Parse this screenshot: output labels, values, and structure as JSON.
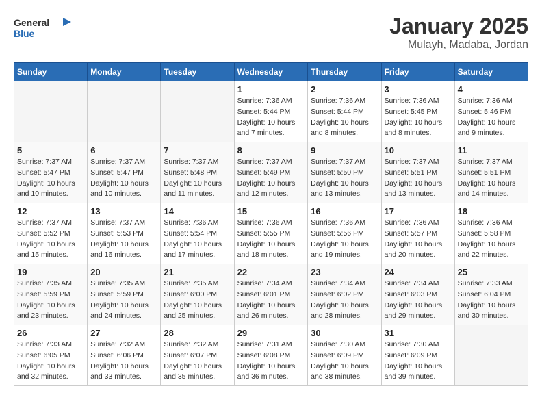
{
  "logo": {
    "general": "General",
    "blue": "Blue"
  },
  "title": "January 2025",
  "subtitle": "Mulayh, Madaba, Jordan",
  "days_of_week": [
    "Sunday",
    "Monday",
    "Tuesday",
    "Wednesday",
    "Thursday",
    "Friday",
    "Saturday"
  ],
  "weeks": [
    [
      {
        "day": "",
        "info": ""
      },
      {
        "day": "",
        "info": ""
      },
      {
        "day": "",
        "info": ""
      },
      {
        "day": "1",
        "info": "Sunrise: 7:36 AM\nSunset: 5:44 PM\nDaylight: 10 hours and 7 minutes."
      },
      {
        "day": "2",
        "info": "Sunrise: 7:36 AM\nSunset: 5:44 PM\nDaylight: 10 hours and 8 minutes."
      },
      {
        "day": "3",
        "info": "Sunrise: 7:36 AM\nSunset: 5:45 PM\nDaylight: 10 hours and 8 minutes."
      },
      {
        "day": "4",
        "info": "Sunrise: 7:36 AM\nSunset: 5:46 PM\nDaylight: 10 hours and 9 minutes."
      }
    ],
    [
      {
        "day": "5",
        "info": "Sunrise: 7:37 AM\nSunset: 5:47 PM\nDaylight: 10 hours and 10 minutes."
      },
      {
        "day": "6",
        "info": "Sunrise: 7:37 AM\nSunset: 5:47 PM\nDaylight: 10 hours and 10 minutes."
      },
      {
        "day": "7",
        "info": "Sunrise: 7:37 AM\nSunset: 5:48 PM\nDaylight: 10 hours and 11 minutes."
      },
      {
        "day": "8",
        "info": "Sunrise: 7:37 AM\nSunset: 5:49 PM\nDaylight: 10 hours and 12 minutes."
      },
      {
        "day": "9",
        "info": "Sunrise: 7:37 AM\nSunset: 5:50 PM\nDaylight: 10 hours and 13 minutes."
      },
      {
        "day": "10",
        "info": "Sunrise: 7:37 AM\nSunset: 5:51 PM\nDaylight: 10 hours and 13 minutes."
      },
      {
        "day": "11",
        "info": "Sunrise: 7:37 AM\nSunset: 5:51 PM\nDaylight: 10 hours and 14 minutes."
      }
    ],
    [
      {
        "day": "12",
        "info": "Sunrise: 7:37 AM\nSunset: 5:52 PM\nDaylight: 10 hours and 15 minutes."
      },
      {
        "day": "13",
        "info": "Sunrise: 7:37 AM\nSunset: 5:53 PM\nDaylight: 10 hours and 16 minutes."
      },
      {
        "day": "14",
        "info": "Sunrise: 7:36 AM\nSunset: 5:54 PM\nDaylight: 10 hours and 17 minutes."
      },
      {
        "day": "15",
        "info": "Sunrise: 7:36 AM\nSunset: 5:55 PM\nDaylight: 10 hours and 18 minutes."
      },
      {
        "day": "16",
        "info": "Sunrise: 7:36 AM\nSunset: 5:56 PM\nDaylight: 10 hours and 19 minutes."
      },
      {
        "day": "17",
        "info": "Sunrise: 7:36 AM\nSunset: 5:57 PM\nDaylight: 10 hours and 20 minutes."
      },
      {
        "day": "18",
        "info": "Sunrise: 7:36 AM\nSunset: 5:58 PM\nDaylight: 10 hours and 22 minutes."
      }
    ],
    [
      {
        "day": "19",
        "info": "Sunrise: 7:35 AM\nSunset: 5:59 PM\nDaylight: 10 hours and 23 minutes."
      },
      {
        "day": "20",
        "info": "Sunrise: 7:35 AM\nSunset: 5:59 PM\nDaylight: 10 hours and 24 minutes."
      },
      {
        "day": "21",
        "info": "Sunrise: 7:35 AM\nSunset: 6:00 PM\nDaylight: 10 hours and 25 minutes."
      },
      {
        "day": "22",
        "info": "Sunrise: 7:34 AM\nSunset: 6:01 PM\nDaylight: 10 hours and 26 minutes."
      },
      {
        "day": "23",
        "info": "Sunrise: 7:34 AM\nSunset: 6:02 PM\nDaylight: 10 hours and 28 minutes."
      },
      {
        "day": "24",
        "info": "Sunrise: 7:34 AM\nSunset: 6:03 PM\nDaylight: 10 hours and 29 minutes."
      },
      {
        "day": "25",
        "info": "Sunrise: 7:33 AM\nSunset: 6:04 PM\nDaylight: 10 hours and 30 minutes."
      }
    ],
    [
      {
        "day": "26",
        "info": "Sunrise: 7:33 AM\nSunset: 6:05 PM\nDaylight: 10 hours and 32 minutes."
      },
      {
        "day": "27",
        "info": "Sunrise: 7:32 AM\nSunset: 6:06 PM\nDaylight: 10 hours and 33 minutes."
      },
      {
        "day": "28",
        "info": "Sunrise: 7:32 AM\nSunset: 6:07 PM\nDaylight: 10 hours and 35 minutes."
      },
      {
        "day": "29",
        "info": "Sunrise: 7:31 AM\nSunset: 6:08 PM\nDaylight: 10 hours and 36 minutes."
      },
      {
        "day": "30",
        "info": "Sunrise: 7:30 AM\nSunset: 6:09 PM\nDaylight: 10 hours and 38 minutes."
      },
      {
        "day": "31",
        "info": "Sunrise: 7:30 AM\nSunset: 6:09 PM\nDaylight: 10 hours and 39 minutes."
      },
      {
        "day": "",
        "info": ""
      }
    ]
  ]
}
